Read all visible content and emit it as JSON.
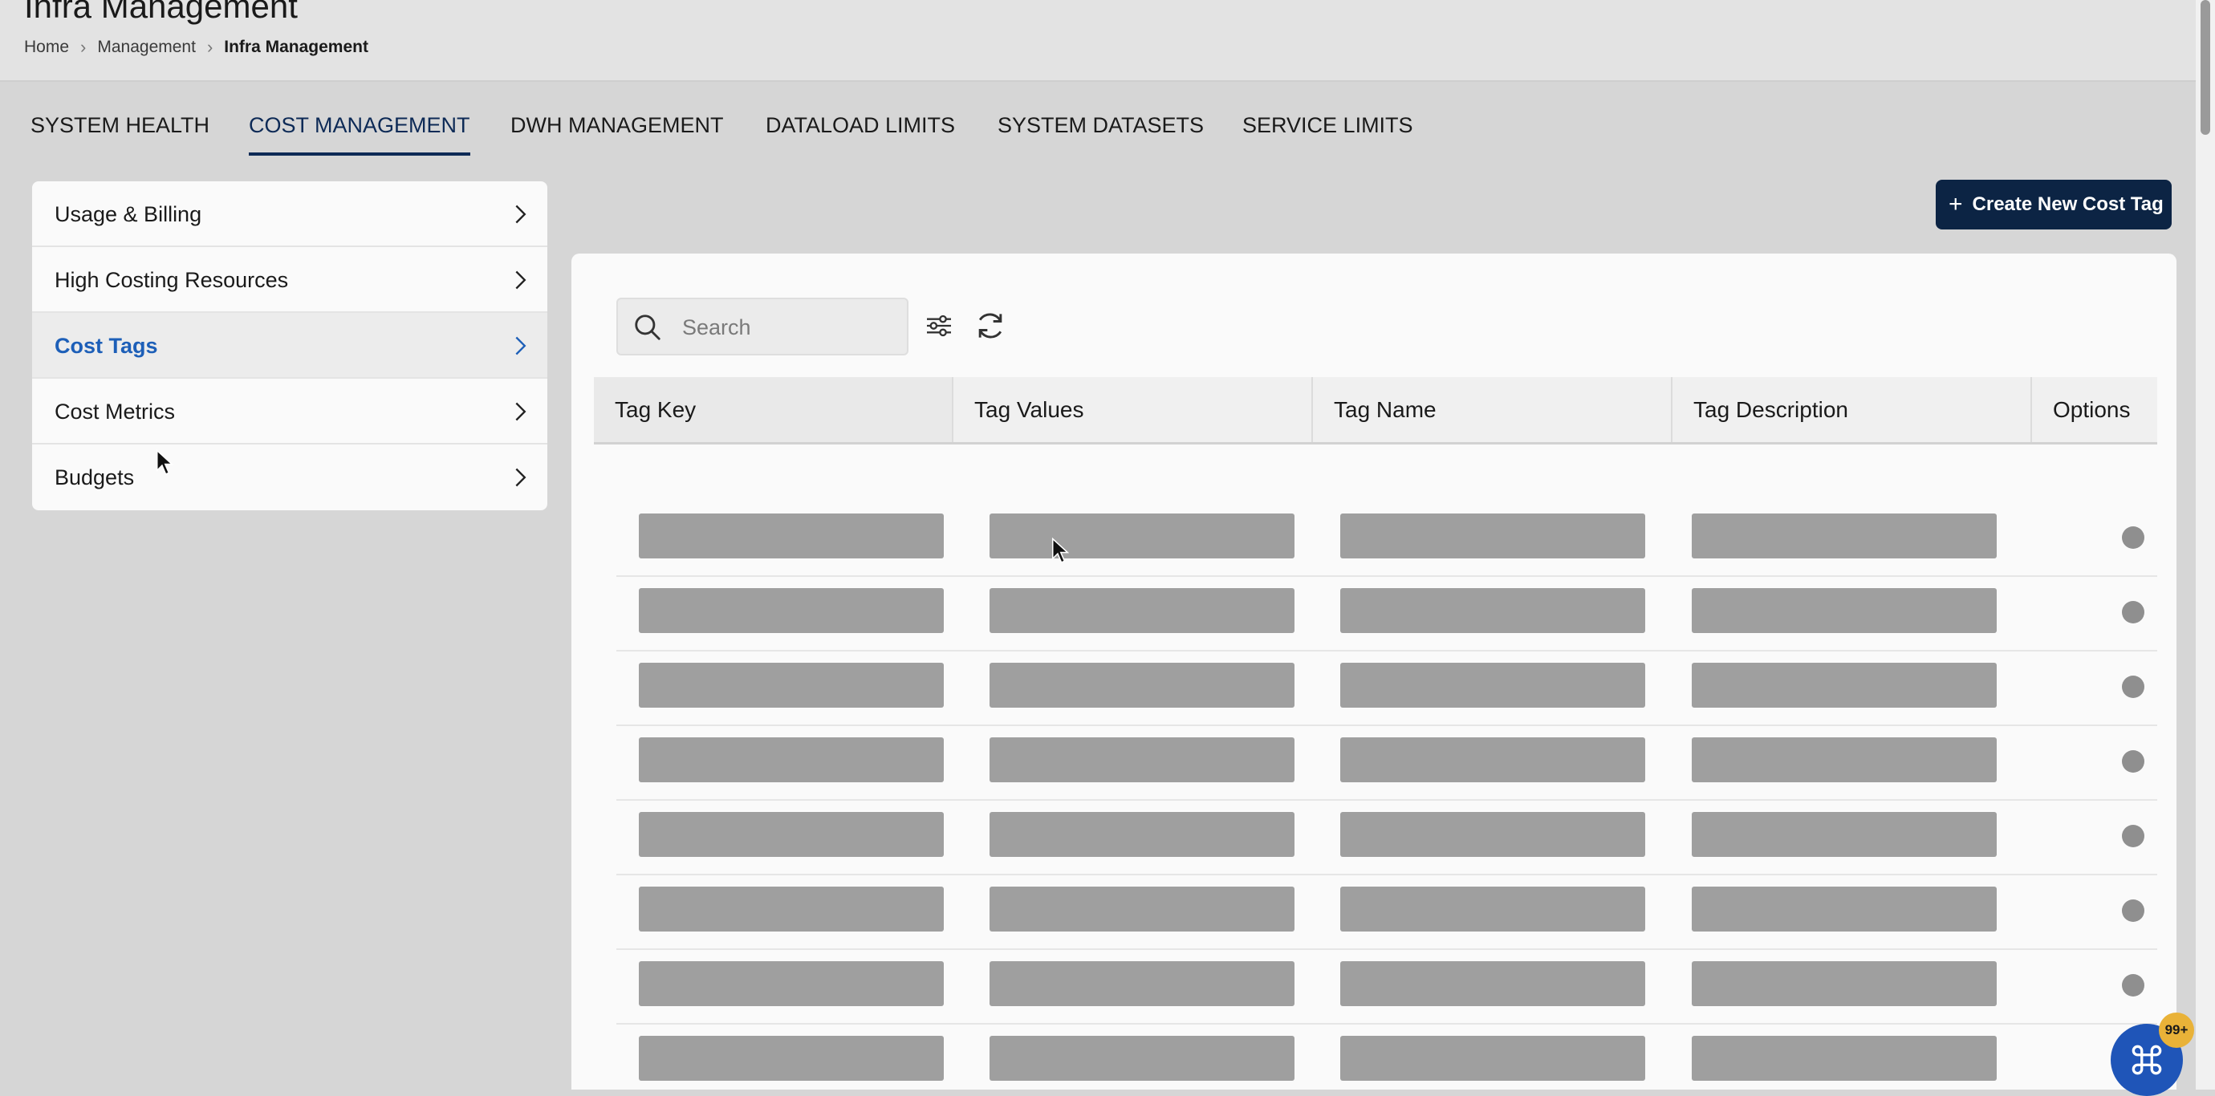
{
  "page": {
    "title": "Infra Management",
    "breadcrumb": [
      "Home",
      "Management",
      "Infra Management"
    ]
  },
  "tabs": [
    {
      "label": "SYSTEM HEALTH",
      "active": false
    },
    {
      "label": "COST MANAGEMENT",
      "active": true
    },
    {
      "label": "DWH MANAGEMENT",
      "active": false
    },
    {
      "label": "DATALOAD LIMITS",
      "active": false
    },
    {
      "label": "SYSTEM DATASETS",
      "active": false
    },
    {
      "label": "SERVICE LIMITS",
      "active": false
    }
  ],
  "side_menu": [
    {
      "label": "Usage & Billing",
      "active": false
    },
    {
      "label": "High Costing Resources",
      "active": false
    },
    {
      "label": "Cost Tags",
      "active": true
    },
    {
      "label": "Cost Metrics",
      "active": false
    },
    {
      "label": "Budgets",
      "active": false
    }
  ],
  "toolbar": {
    "create_label": "Create New Cost Tag",
    "search_placeholder": "Search"
  },
  "table": {
    "columns": [
      "Tag Key",
      "Tag Values",
      "Tag Name",
      "Tag Description",
      "Options"
    ],
    "loading_rows": 8
  },
  "fab": {
    "badge": "99+"
  },
  "colors": {
    "primary": "#0c2444",
    "active_link": "#1d5fb8",
    "skeleton": "#9f9f9f",
    "badge": "#e9b238"
  }
}
